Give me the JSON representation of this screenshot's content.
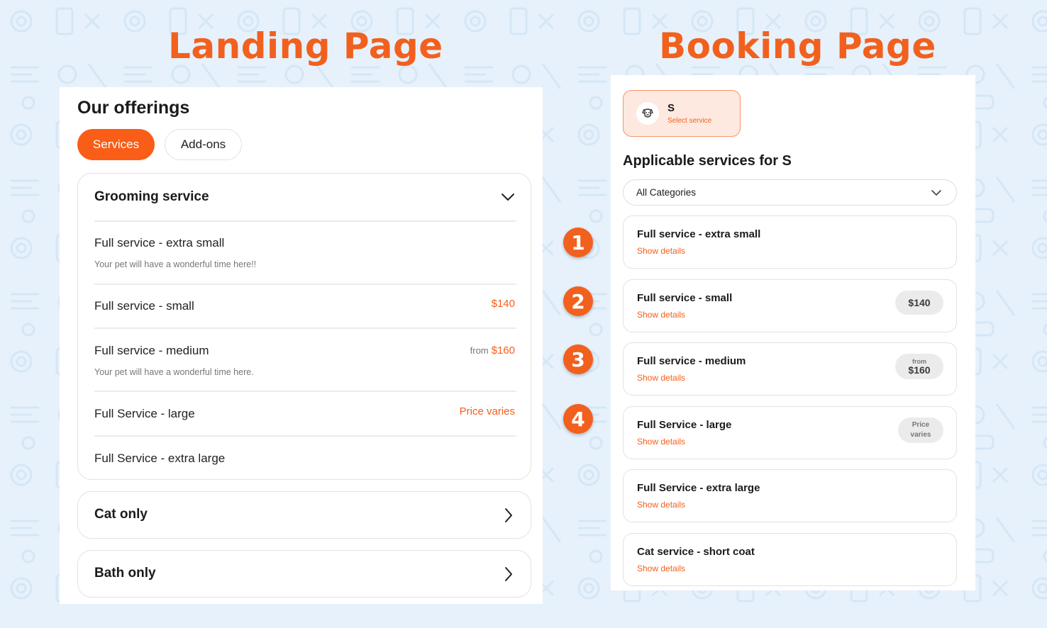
{
  "headings": {
    "landing": "Landing Page",
    "booking": "Booking Page"
  },
  "colors": {
    "accent": "#f2601e",
    "background": "#e6f1fb"
  },
  "landing": {
    "title": "Our offerings",
    "tabs": [
      "Services",
      "Add-ons"
    ],
    "active_tab": "Services",
    "open_category": {
      "title": "Grooming service",
      "services": [
        {
          "name": "Full service - extra small",
          "desc": "Your pet will have a wonderful time here!!",
          "price": "",
          "from": ""
        },
        {
          "name": "Full service - small",
          "desc": "",
          "price": "$140",
          "from": ""
        },
        {
          "name": "Full service - medium",
          "desc": "Your pet will have a wonderful time here.",
          "price": "$160",
          "from": "from"
        },
        {
          "name": "Full Service - large",
          "desc": "",
          "price": "Price varies",
          "from": ""
        },
        {
          "name": "Full Service - extra large",
          "desc": "",
          "price": "",
          "from": ""
        }
      ]
    },
    "closed_categories": [
      "Cat only",
      "Bath only"
    ]
  },
  "booking": {
    "pet": {
      "name": "S",
      "subtitle": "Select service",
      "icon": "dog-face-icon"
    },
    "title": "Applicable services for S",
    "category_filter": "All Categories",
    "details_label": "Show details",
    "services": [
      {
        "name": "Full service - extra small",
        "price": ""
      },
      {
        "name": "Full service - small",
        "price": "$140"
      },
      {
        "name": "Full service - medium",
        "price": "$160",
        "from": "from"
      },
      {
        "name": "Full Service - large",
        "price_lines": [
          "Price",
          "varies"
        ]
      },
      {
        "name": "Full Service - extra large",
        "price": ""
      },
      {
        "name": "Cat service - short coat",
        "price": ""
      }
    ]
  },
  "markers": [
    "1",
    "2",
    "3",
    "4"
  ]
}
